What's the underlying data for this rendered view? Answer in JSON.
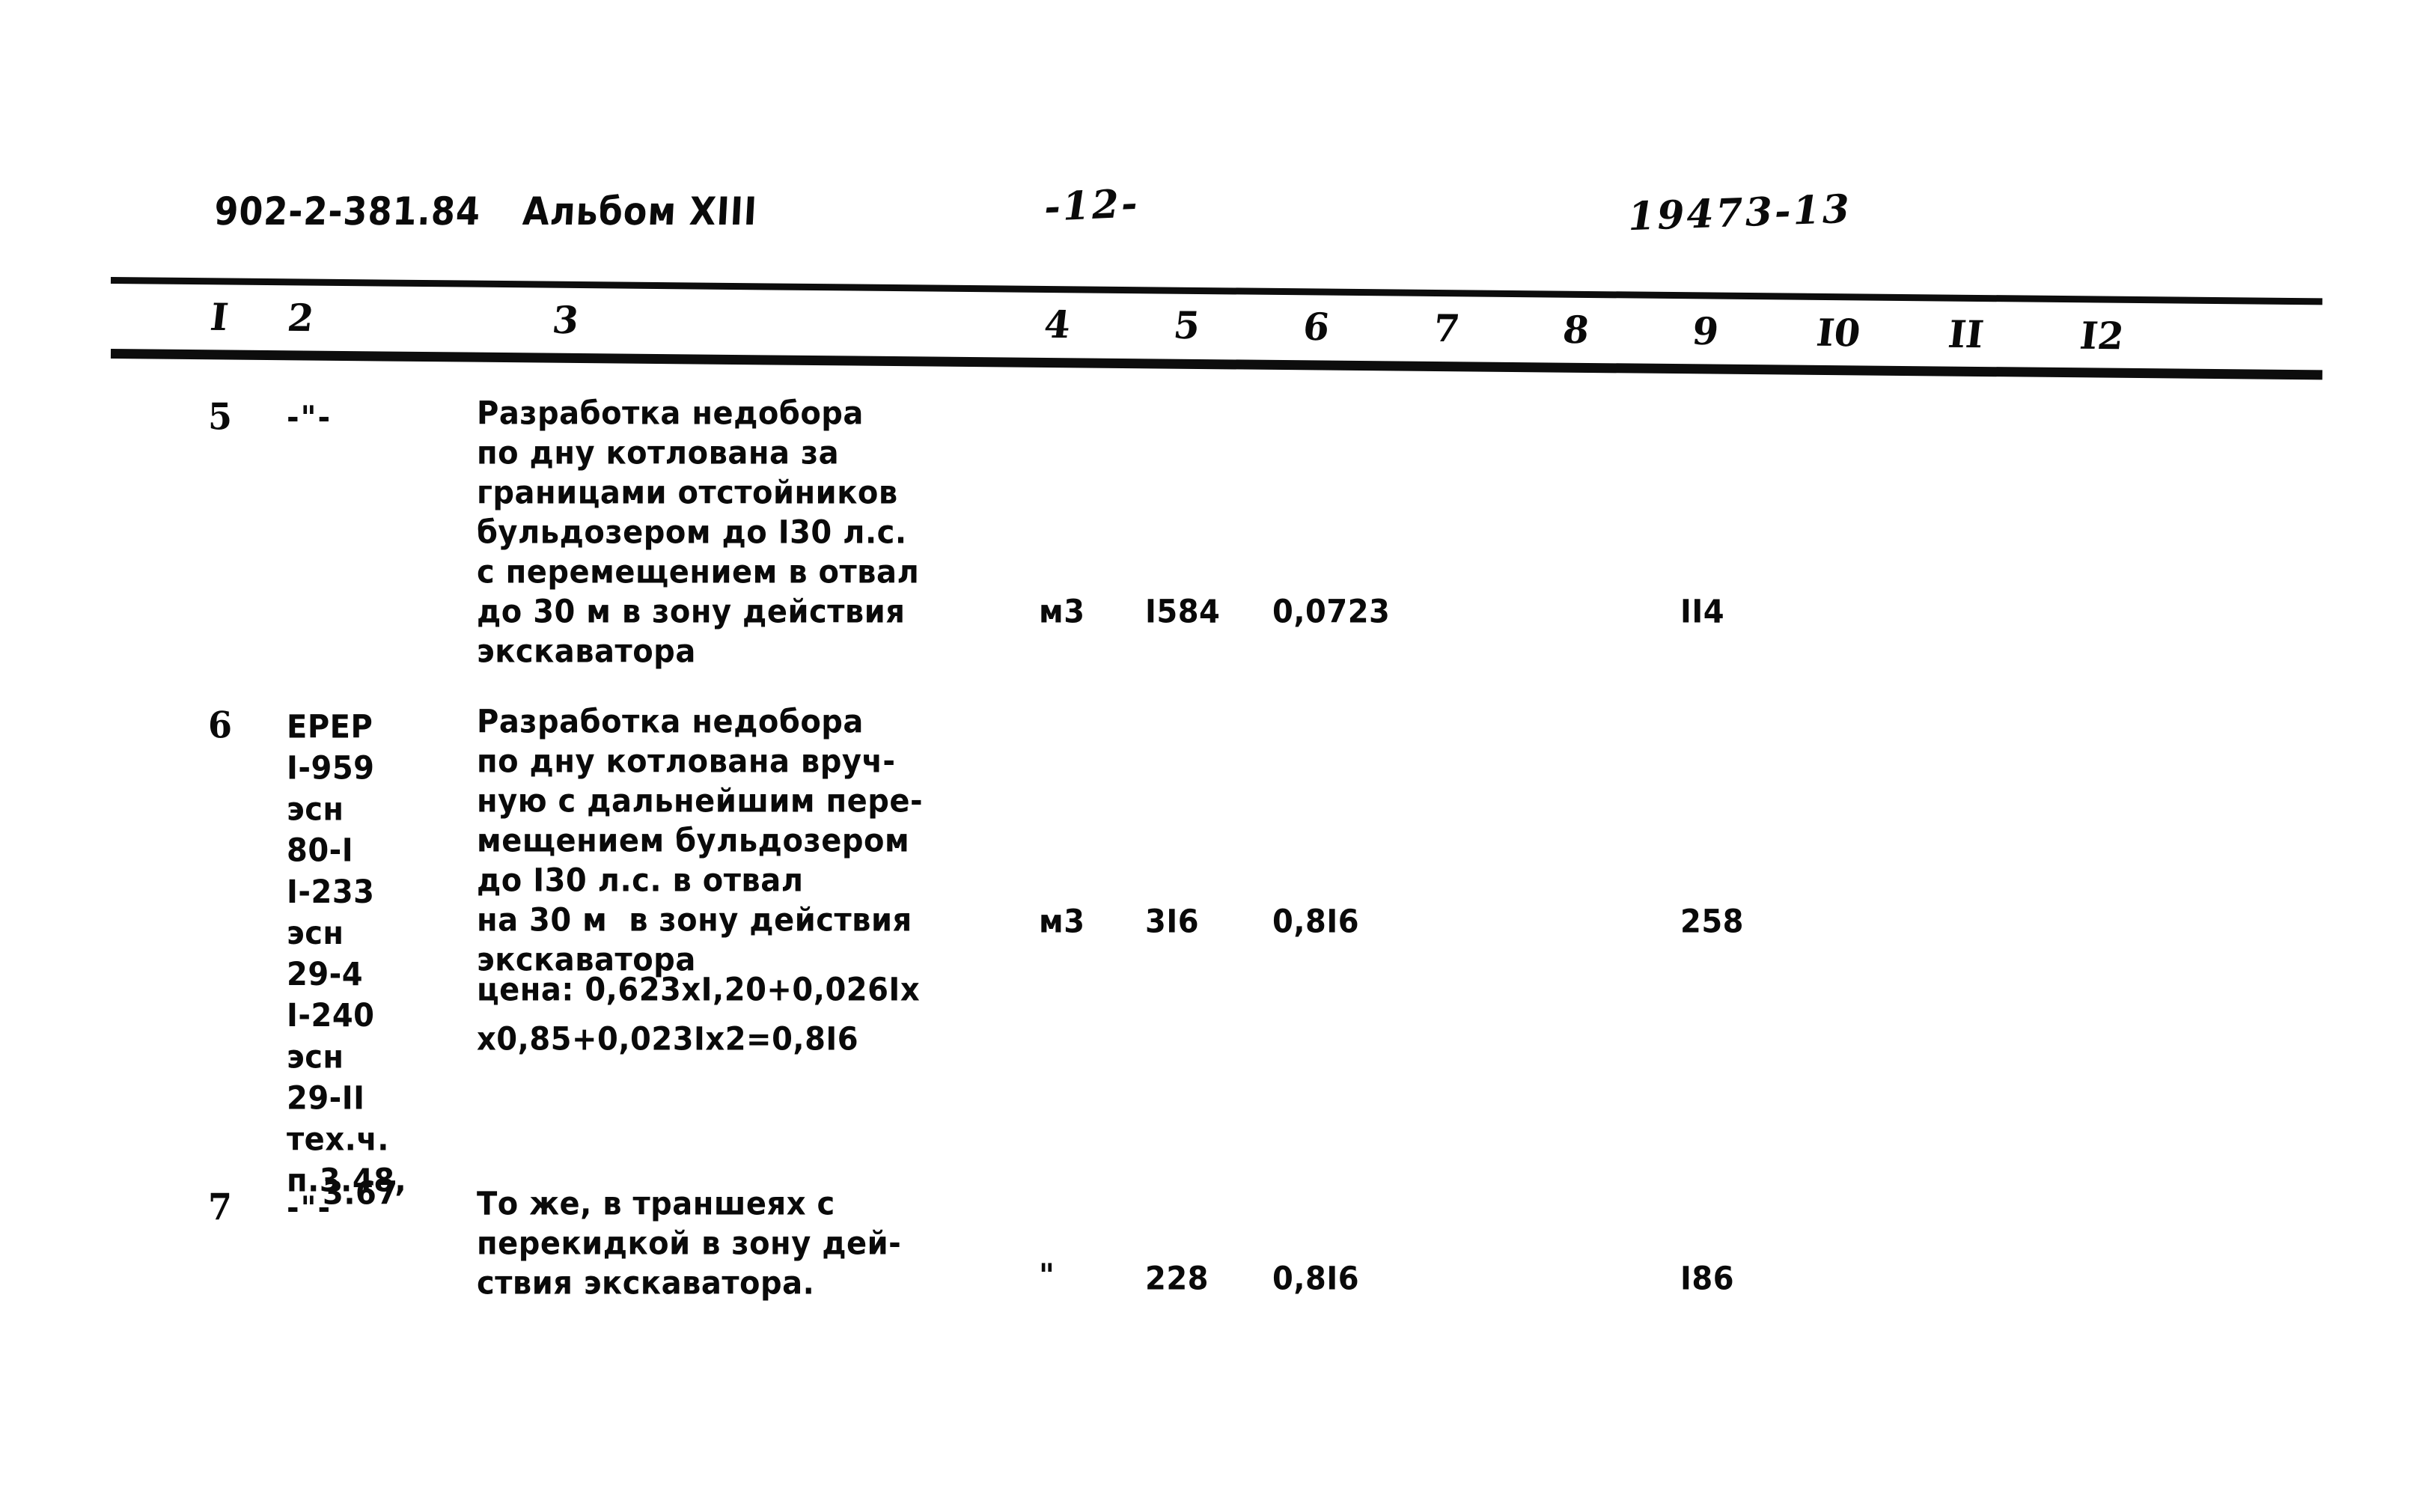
{
  "document": {
    "series_code": "902-2-381.84",
    "album": "Альбом XIII",
    "page_number": "-12-",
    "sheet_code": "19473-13"
  },
  "table": {
    "column_numbers": [
      "I",
      "2",
      "3",
      "4",
      "5",
      "6",
      "7",
      "8",
      "9",
      "I0",
      "II",
      "I2"
    ],
    "rows": [
      {
        "num": "5",
        "code": "-\"-",
        "description": "Разработка недобора\nпо дну котлована за\nграницами отстойников\nбульдозером до I30 л.с.\nс перемещением в отвал\nдо 30 м в зону действия\nэкскаватора",
        "unit": "м3",
        "qty": "I584",
        "price": "0,0723",
        "col7": "",
        "col8": "",
        "col9": "II4",
        "col10": "",
        "col11": "",
        "col12": ""
      },
      {
        "num": "6",
        "code": "ЕРЕР\nI-959\nэсн\n80-I\nI-233\nэсн\n29-4\nI-240\nэсн\n29-II\nтех.ч.\nп.3.48,",
        "code_last": "3.67",
        "description": "Разработка недобора\nпо дну котлована вруч-\nную с дальнейшим пере-\nмещением бульдозером\nдо I30 л.с. в отвал\nна 30 м  в зону действия\nэкскаватора",
        "formula": "цена: 0,623xI,20+0,026Ix\nx0,85+0,023Ix2=0,8I6",
        "unit": "м3",
        "qty": "3I6",
        "price": "0,8I6",
        "col7": "",
        "col8": "",
        "col9": "258",
        "col10": "",
        "col11": "",
        "col12": ""
      },
      {
        "num": "7",
        "code": "-\"-",
        "description": "То же, в траншеях с\nперекидкой в зону дей-\nствия экскаватора.",
        "unit": "\"",
        "qty": "228",
        "price": "0,8I6",
        "col7": "",
        "col8": "",
        "col9": "I86",
        "col10": "",
        "col11": "",
        "col12": ""
      }
    ]
  }
}
